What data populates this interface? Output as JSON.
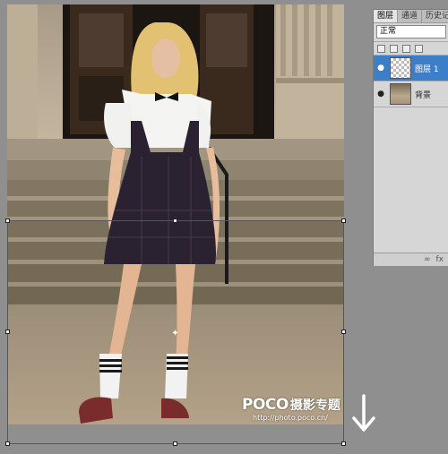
{
  "panel": {
    "tabs": [
      "图层",
      "通道",
      "历史记"
    ],
    "blend_mode": "正常",
    "layers": [
      {
        "name": "图层 1",
        "selected": true,
        "thumbnail": "transparent"
      },
      {
        "name": "背景",
        "selected": false,
        "thumbnail": "photo"
      }
    ],
    "footer": {
      "link_icon": "link-icon",
      "fx_label": "fx"
    }
  },
  "watermark": {
    "logo": "POCO",
    "cn": "摄影专题",
    "url": "http://photo.poco.cn/"
  },
  "icons": {
    "visibility": "eye-icon",
    "down_arrow": "arrow-down-icon"
  },
  "colors": {
    "selection": "#3d7ec9",
    "workspace": "#8f8f8f"
  }
}
